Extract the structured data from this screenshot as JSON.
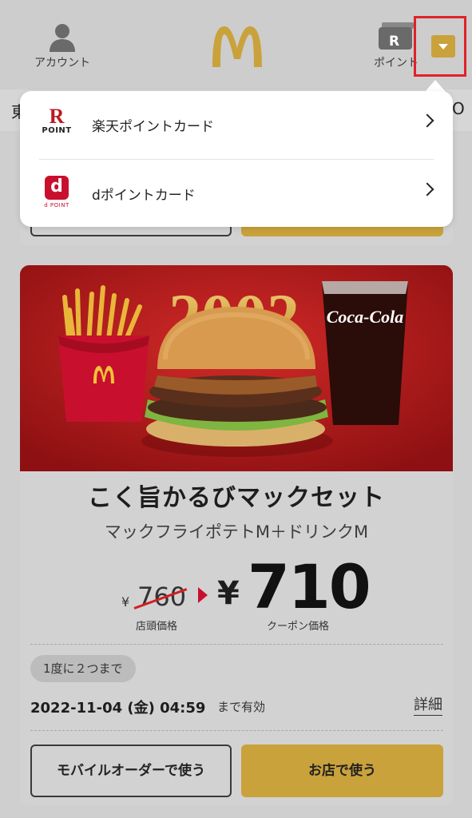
{
  "header": {
    "account_label": "アカウント",
    "points_label": "ポイント",
    "points_card_glyph": "R",
    "logo_glyph": "M",
    "subbar_left": "東",
    "subbar_right": "O"
  },
  "point_menu": {
    "items": [
      {
        "label": "楽天ポイントカード",
        "logo_main": "R",
        "logo_sub": "POINT",
        "icon": "rakuten-point-logo"
      },
      {
        "label": "dポイントカード",
        "logo_main": "d",
        "logo_sub": "d POINT",
        "icon": "d-point-logo"
      }
    ]
  },
  "coupon": {
    "banner_year": "2002",
    "banner_brand": "Coca-Cola",
    "title": "こく旨かるびマックセット",
    "subtitle": "マックフライポテトM＋ドリンクM",
    "yen_symbol": "¥",
    "old_price": "760",
    "old_price_label": "店頭価格",
    "new_price": "710",
    "new_price_label": "クーポン価格",
    "limit": "1度に２つまで",
    "valid_until": "2022-11-04 (金) 04:59",
    "valid_suffix": "まで有効",
    "detail_label": "詳細",
    "mobile_order_button": "モバイルオーダーで使う",
    "store_button": "お店で使う"
  },
  "colors": {
    "accent": "#c9a23b",
    "highlight": "#e0222a",
    "brand_red": "#c8102e"
  }
}
